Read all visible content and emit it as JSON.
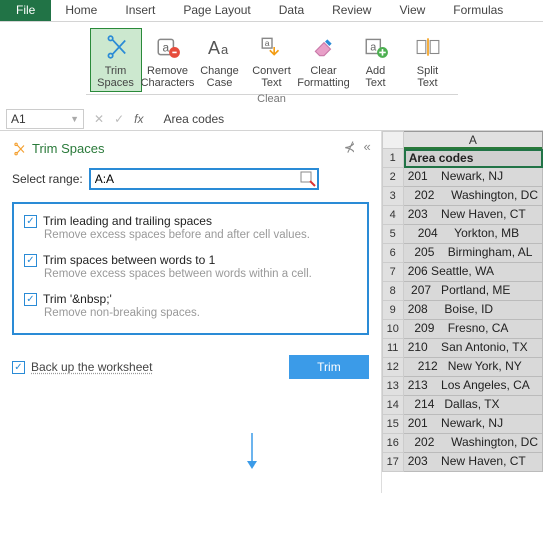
{
  "tabs": {
    "file": "File",
    "items": [
      "Home",
      "Insert",
      "Page Layout",
      "Data",
      "Review",
      "View",
      "Formulas"
    ]
  },
  "ribbon": {
    "group_label": "Clean",
    "buttons": [
      {
        "label": "Trim\nSpaces",
        "icon": "scissors"
      },
      {
        "label": "Remove\nCharacters",
        "icon": "remove-chars"
      },
      {
        "label": "Change\nCase",
        "icon": "change-case"
      },
      {
        "label": "Convert\nText",
        "icon": "convert-text"
      },
      {
        "label": "Clear\nFormatting",
        "icon": "eraser"
      },
      {
        "label": "Add\nText",
        "icon": "add-text"
      },
      {
        "label": "Split\nText",
        "icon": "split-text"
      }
    ]
  },
  "namebox": "A1",
  "formula_value": "Area codes",
  "pane": {
    "title": "Trim Spaces",
    "select_label": "Select range:",
    "select_value": "A:A",
    "opts": [
      {
        "title": "Trim leading and trailing spaces",
        "desc": "Remove excess spaces before and after cell values."
      },
      {
        "title": "Trim spaces between words to 1",
        "desc": "Remove excess spaces between words within a cell."
      },
      {
        "title": "Trim '&nbsp;'",
        "desc": "Remove non-breaking spaces."
      }
    ],
    "backup_label": "Back up the worksheet",
    "button": "Trim"
  },
  "sheet": {
    "col": "A",
    "rows": [
      "Area codes",
      "201    Newark, NJ",
      "  202     Washington, DC",
      "203    New Haven, CT",
      "   204     Yorkton, MB",
      "  205    Birmingham, AL",
      "206 Seattle, WA",
      " 207   Portland, ME",
      "208     Boise, ID",
      "  209    Fresno, CA",
      "210    San Antonio, TX",
      "   212   New York, NY",
      "213    Los Angeles, CA",
      "  214   Dallas, TX",
      "201    Newark, NJ",
      "  202     Washington, DC",
      "203    New Haven, CT"
    ]
  }
}
